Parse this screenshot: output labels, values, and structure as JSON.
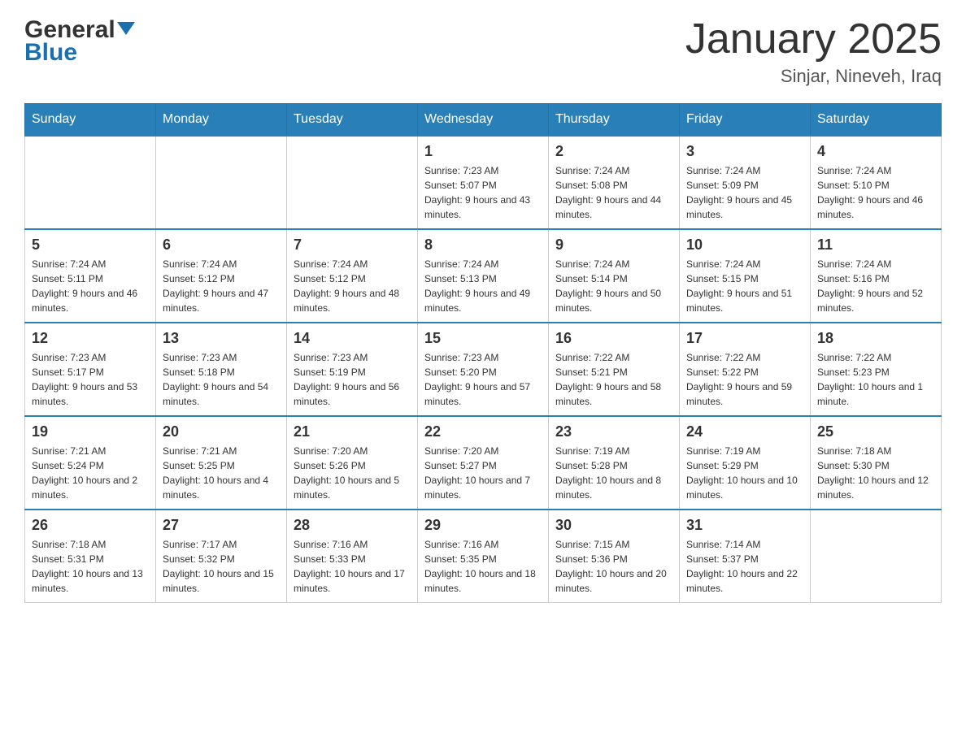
{
  "header": {
    "logo_general": "General",
    "logo_blue": "Blue",
    "title": "January 2025",
    "subtitle": "Sinjar, Nineveh, Iraq"
  },
  "weekdays": [
    "Sunday",
    "Monday",
    "Tuesday",
    "Wednesday",
    "Thursday",
    "Friday",
    "Saturday"
  ],
  "weeks": [
    [
      {
        "day": "",
        "sunrise": "",
        "sunset": "",
        "daylight": ""
      },
      {
        "day": "",
        "sunrise": "",
        "sunset": "",
        "daylight": ""
      },
      {
        "day": "",
        "sunrise": "",
        "sunset": "",
        "daylight": ""
      },
      {
        "day": "1",
        "sunrise": "Sunrise: 7:23 AM",
        "sunset": "Sunset: 5:07 PM",
        "daylight": "Daylight: 9 hours and 43 minutes."
      },
      {
        "day": "2",
        "sunrise": "Sunrise: 7:24 AM",
        "sunset": "Sunset: 5:08 PM",
        "daylight": "Daylight: 9 hours and 44 minutes."
      },
      {
        "day": "3",
        "sunrise": "Sunrise: 7:24 AM",
        "sunset": "Sunset: 5:09 PM",
        "daylight": "Daylight: 9 hours and 45 minutes."
      },
      {
        "day": "4",
        "sunrise": "Sunrise: 7:24 AM",
        "sunset": "Sunset: 5:10 PM",
        "daylight": "Daylight: 9 hours and 46 minutes."
      }
    ],
    [
      {
        "day": "5",
        "sunrise": "Sunrise: 7:24 AM",
        "sunset": "Sunset: 5:11 PM",
        "daylight": "Daylight: 9 hours and 46 minutes."
      },
      {
        "day": "6",
        "sunrise": "Sunrise: 7:24 AM",
        "sunset": "Sunset: 5:12 PM",
        "daylight": "Daylight: 9 hours and 47 minutes."
      },
      {
        "day": "7",
        "sunrise": "Sunrise: 7:24 AM",
        "sunset": "Sunset: 5:12 PM",
        "daylight": "Daylight: 9 hours and 48 minutes."
      },
      {
        "day": "8",
        "sunrise": "Sunrise: 7:24 AM",
        "sunset": "Sunset: 5:13 PM",
        "daylight": "Daylight: 9 hours and 49 minutes."
      },
      {
        "day": "9",
        "sunrise": "Sunrise: 7:24 AM",
        "sunset": "Sunset: 5:14 PM",
        "daylight": "Daylight: 9 hours and 50 minutes."
      },
      {
        "day": "10",
        "sunrise": "Sunrise: 7:24 AM",
        "sunset": "Sunset: 5:15 PM",
        "daylight": "Daylight: 9 hours and 51 minutes."
      },
      {
        "day": "11",
        "sunrise": "Sunrise: 7:24 AM",
        "sunset": "Sunset: 5:16 PM",
        "daylight": "Daylight: 9 hours and 52 minutes."
      }
    ],
    [
      {
        "day": "12",
        "sunrise": "Sunrise: 7:23 AM",
        "sunset": "Sunset: 5:17 PM",
        "daylight": "Daylight: 9 hours and 53 minutes."
      },
      {
        "day": "13",
        "sunrise": "Sunrise: 7:23 AM",
        "sunset": "Sunset: 5:18 PM",
        "daylight": "Daylight: 9 hours and 54 minutes."
      },
      {
        "day": "14",
        "sunrise": "Sunrise: 7:23 AM",
        "sunset": "Sunset: 5:19 PM",
        "daylight": "Daylight: 9 hours and 56 minutes."
      },
      {
        "day": "15",
        "sunrise": "Sunrise: 7:23 AM",
        "sunset": "Sunset: 5:20 PM",
        "daylight": "Daylight: 9 hours and 57 minutes."
      },
      {
        "day": "16",
        "sunrise": "Sunrise: 7:22 AM",
        "sunset": "Sunset: 5:21 PM",
        "daylight": "Daylight: 9 hours and 58 minutes."
      },
      {
        "day": "17",
        "sunrise": "Sunrise: 7:22 AM",
        "sunset": "Sunset: 5:22 PM",
        "daylight": "Daylight: 9 hours and 59 minutes."
      },
      {
        "day": "18",
        "sunrise": "Sunrise: 7:22 AM",
        "sunset": "Sunset: 5:23 PM",
        "daylight": "Daylight: 10 hours and 1 minute."
      }
    ],
    [
      {
        "day": "19",
        "sunrise": "Sunrise: 7:21 AM",
        "sunset": "Sunset: 5:24 PM",
        "daylight": "Daylight: 10 hours and 2 minutes."
      },
      {
        "day": "20",
        "sunrise": "Sunrise: 7:21 AM",
        "sunset": "Sunset: 5:25 PM",
        "daylight": "Daylight: 10 hours and 4 minutes."
      },
      {
        "day": "21",
        "sunrise": "Sunrise: 7:20 AM",
        "sunset": "Sunset: 5:26 PM",
        "daylight": "Daylight: 10 hours and 5 minutes."
      },
      {
        "day": "22",
        "sunrise": "Sunrise: 7:20 AM",
        "sunset": "Sunset: 5:27 PM",
        "daylight": "Daylight: 10 hours and 7 minutes."
      },
      {
        "day": "23",
        "sunrise": "Sunrise: 7:19 AM",
        "sunset": "Sunset: 5:28 PM",
        "daylight": "Daylight: 10 hours and 8 minutes."
      },
      {
        "day": "24",
        "sunrise": "Sunrise: 7:19 AM",
        "sunset": "Sunset: 5:29 PM",
        "daylight": "Daylight: 10 hours and 10 minutes."
      },
      {
        "day": "25",
        "sunrise": "Sunrise: 7:18 AM",
        "sunset": "Sunset: 5:30 PM",
        "daylight": "Daylight: 10 hours and 12 minutes."
      }
    ],
    [
      {
        "day": "26",
        "sunrise": "Sunrise: 7:18 AM",
        "sunset": "Sunset: 5:31 PM",
        "daylight": "Daylight: 10 hours and 13 minutes."
      },
      {
        "day": "27",
        "sunrise": "Sunrise: 7:17 AM",
        "sunset": "Sunset: 5:32 PM",
        "daylight": "Daylight: 10 hours and 15 minutes."
      },
      {
        "day": "28",
        "sunrise": "Sunrise: 7:16 AM",
        "sunset": "Sunset: 5:33 PM",
        "daylight": "Daylight: 10 hours and 17 minutes."
      },
      {
        "day": "29",
        "sunrise": "Sunrise: 7:16 AM",
        "sunset": "Sunset: 5:35 PM",
        "daylight": "Daylight: 10 hours and 18 minutes."
      },
      {
        "day": "30",
        "sunrise": "Sunrise: 7:15 AM",
        "sunset": "Sunset: 5:36 PM",
        "daylight": "Daylight: 10 hours and 20 minutes."
      },
      {
        "day": "31",
        "sunrise": "Sunrise: 7:14 AM",
        "sunset": "Sunset: 5:37 PM",
        "daylight": "Daylight: 10 hours and 22 minutes."
      },
      {
        "day": "",
        "sunrise": "",
        "sunset": "",
        "daylight": ""
      }
    ]
  ]
}
